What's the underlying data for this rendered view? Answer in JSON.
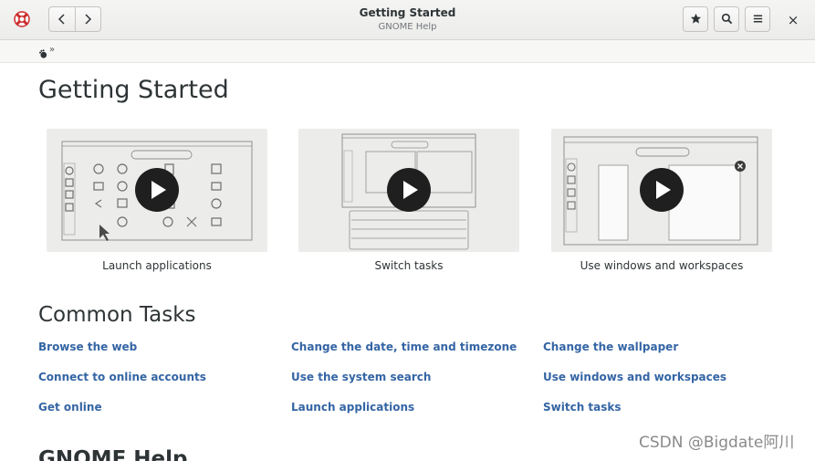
{
  "window": {
    "title": "Getting Started",
    "subtitle": "GNOME Help"
  },
  "toolbar": {
    "back_icon": "chevron-left-icon",
    "forward_icon": "chevron-right-icon",
    "bookmark_icon": "star-icon",
    "search_icon": "search-icon",
    "menu_icon": "hamburger-menu-icon",
    "close_label": "×"
  },
  "breadcrumb": {
    "separator": "»"
  },
  "page": {
    "heading": "Getting Started"
  },
  "videos": [
    {
      "caption": "Launch applications"
    },
    {
      "caption": "Switch tasks"
    },
    {
      "caption": "Use windows and workspaces"
    }
  ],
  "common_tasks": {
    "heading": "Common Tasks",
    "links": [
      "Browse the web",
      "Change the date, time and timezone",
      "Change the wallpaper",
      "Connect to online accounts",
      "Use the system search",
      "Use windows and workspaces",
      "Get online",
      "Launch applications",
      "Switch tasks"
    ]
  },
  "next_section": {
    "heading": "GNOME Help"
  },
  "watermark": "CSDN @Bigdate阿川",
  "colors": {
    "link": "#3465a4",
    "play_button": "#1f1f1f",
    "thumbnail_bg": "#ececeb"
  }
}
